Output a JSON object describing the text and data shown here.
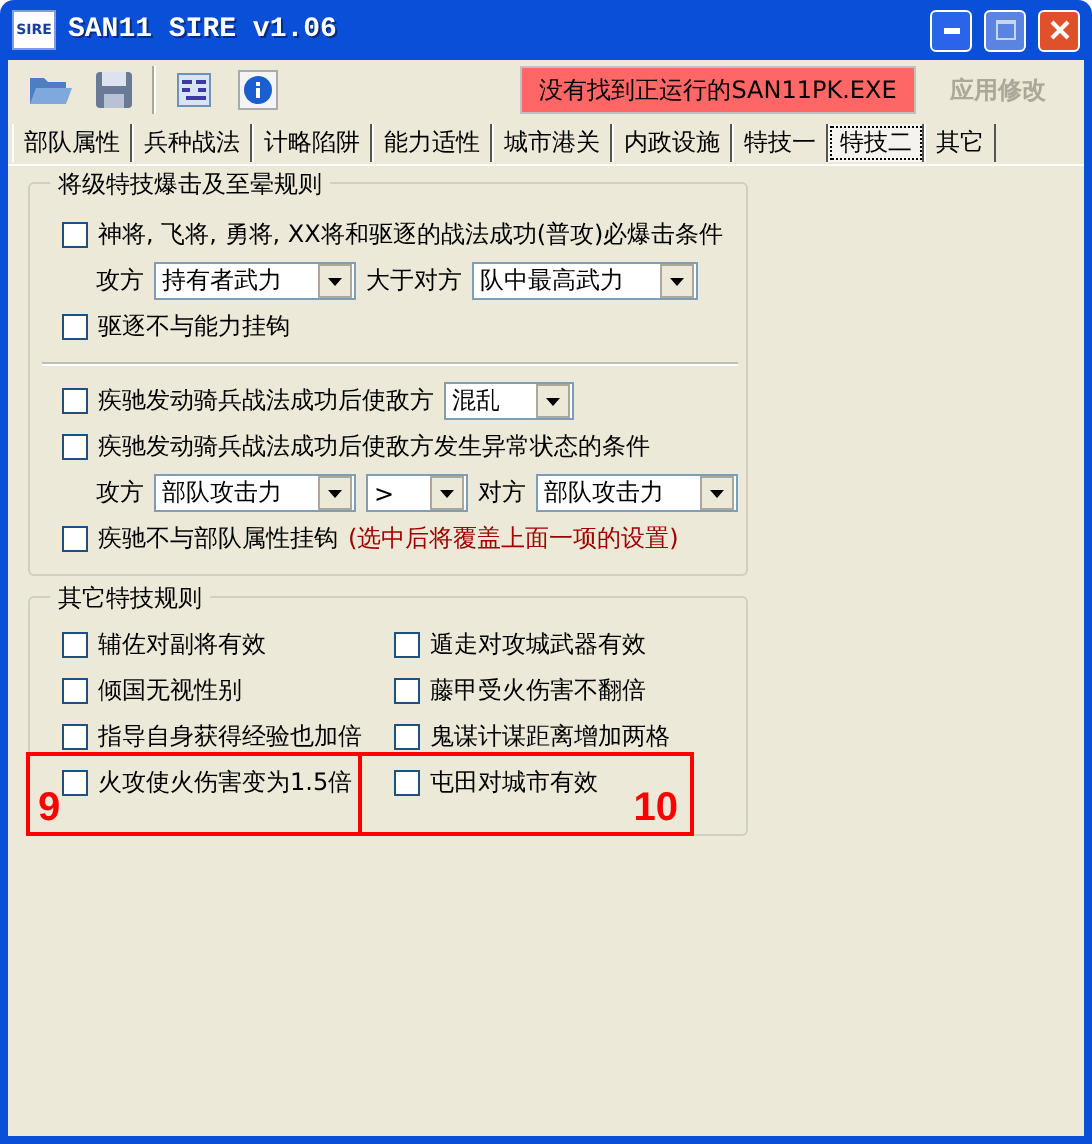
{
  "window": {
    "title": "SAN11 SIRE v1.06",
    "logo": "SIRE"
  },
  "toolbar": {
    "status": "没有找到正运行的SAN11PK.EXE",
    "apply_button": {
      "label": "应用修改",
      "disabled": true
    }
  },
  "tabs": [
    {
      "label": "部队属性",
      "selected": false
    },
    {
      "label": "兵种战法",
      "selected": false
    },
    {
      "label": "计略陷阱",
      "selected": false
    },
    {
      "label": "能力适性",
      "selected": false
    },
    {
      "label": "城市港关",
      "selected": false
    },
    {
      "label": "内政设施",
      "selected": false
    },
    {
      "label": "特技一",
      "selected": false
    },
    {
      "label": "特技二",
      "selected": true
    },
    {
      "label": "其它",
      "selected": false
    }
  ],
  "group_1": {
    "title": "将级特技爆击及至晕规则",
    "rows": [
      {
        "kind": "checkbox",
        "label": "神将, 飞将, 勇将, XX将和驱逐的战法成功(普攻)必爆击条件",
        "checked": false
      },
      {
        "kind": "combos",
        "items": [
          {
            "kind": "text",
            "label": "攻方"
          },
          {
            "kind": "combo",
            "value": "持有者武力"
          },
          {
            "kind": "text",
            "label": "大于对方"
          },
          {
            "kind": "combo",
            "value": "队中最高武力"
          }
        ]
      },
      {
        "kind": "checkbox",
        "label": "驱逐不与能力挂钩",
        "checked": false
      },
      {
        "kind": "divider"
      },
      {
        "kind": "checkbox",
        "label": "疾驰发动骑兵战法成功后使敌方",
        "checked": false,
        "combo": "混乱"
      },
      {
        "kind": "checkbox",
        "label": "疾驰发动骑兵战法成功后使敌方发生异常状态的条件",
        "checked": false
      },
      {
        "kind": "combos",
        "items": [
          {
            "kind": "text",
            "label": "攻方"
          },
          {
            "kind": "combo",
            "value": "部队攻击力"
          },
          {
            "kind": "combo",
            "value": ">"
          },
          {
            "kind": "text",
            "label": "对方"
          },
          {
            "kind": "combo",
            "value": "部队攻击力"
          }
        ]
      },
      {
        "kind": "checkbox",
        "label": "疾驰不与部队属性挂钩",
        "checked": false,
        "note": "(选中后将覆盖上面一项的设置)"
      }
    ]
  },
  "group_2": {
    "title": "其它特技规则",
    "items": [
      {
        "label": "辅佐对副将有效",
        "checked": false
      },
      {
        "label": "遁走对攻城武器有效",
        "checked": false
      },
      {
        "label": "倾国无视性别",
        "checked": false
      },
      {
        "label": "藤甲受火伤害不翻倍",
        "checked": false
      },
      {
        "label": "指导自身获得经验也加倍",
        "checked": false
      },
      {
        "label": "鬼谋计谋距离增加两格",
        "checked": false
      },
      {
        "label": "火攻使火伤害变为1.5倍",
        "checked": false,
        "annotation": "9"
      },
      {
        "label": "屯田对城市有效",
        "checked": false,
        "annotation": "10"
      }
    ]
  }
}
